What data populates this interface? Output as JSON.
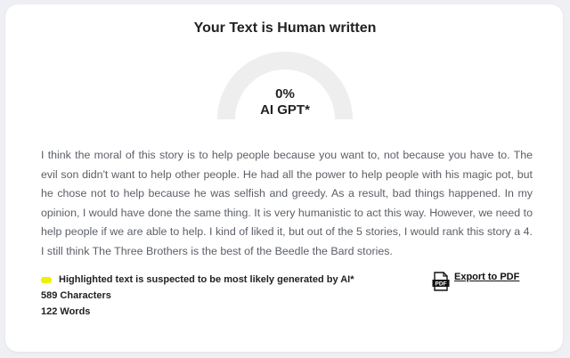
{
  "result": {
    "title": "Your Text is Human written",
    "gauge_value": "0%",
    "gauge_label": "AI GPT*",
    "gauge_fraction": 0.0,
    "gauge_track_color": "#eeeeee",
    "gauge_fill_color": "#f2c94c"
  },
  "analyzed_text": "I think the moral of this story is to help people because you want to, not because you have to. The evil son didn't want to help other people. He had all the power to help people with his magic pot, but he chose not to help because he was selfish and greedy. As a result, bad things happened. In my opinion, I would have done the same thing. It is very humanistic to act this way. However, we need to help people if we are able to help. I kind of liked it, but out of the 5 stories, I would rank this story a 4. I still think The Three Brothers is the best of the Beedle the Bard stories.",
  "legend": {
    "text": "Highlighted text is suspected to be most likely generated by AI*",
    "color": "#f0f000"
  },
  "stats": {
    "characters": "589 Characters",
    "words": "122 Words"
  },
  "export": {
    "label": "Export to PDF",
    "icon": "pdf-icon",
    "icon_text": "PDF"
  }
}
